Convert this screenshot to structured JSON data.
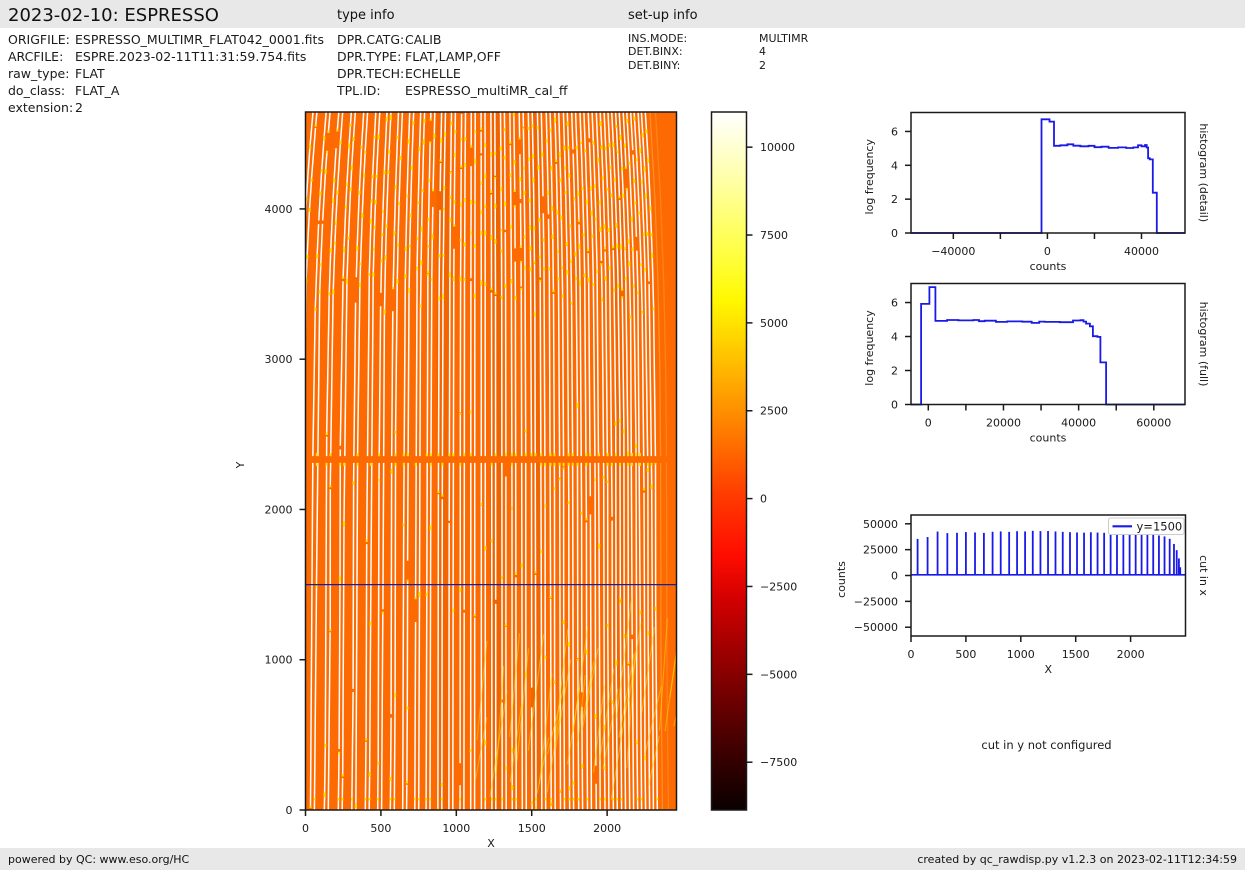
{
  "header": {
    "title": "2023-02-10: ESPRESSO",
    "type_info_label": "type info",
    "setup_info_label": "set-up info"
  },
  "file_info": {
    "rows": [
      {
        "label": "ORIGFILE:",
        "value": "ESPRESSO_MULTIMR_FLAT042_0001.fits"
      },
      {
        "label": "ARCFILE:",
        "value": "ESPRE.2023-02-11T11:31:59.754.fits"
      },
      {
        "label": "raw_type:",
        "value": "FLAT"
      },
      {
        "label": "do_class:",
        "value": "FLAT_A"
      },
      {
        "label": "extension:",
        "value": "2"
      }
    ]
  },
  "type_info": {
    "rows": [
      {
        "label": "DPR.CATG:",
        "value": "CALIB"
      },
      {
        "label": "DPR.TYPE:",
        "value": "FLAT,LAMP,OFF"
      },
      {
        "label": "DPR.TECH:",
        "value": "ECHELLE"
      },
      {
        "label": "TPL.ID:",
        "value": "ESPRESSO_multiMR_cal_ff"
      }
    ]
  },
  "setup_info": {
    "rows": [
      {
        "label": "INS.MODE:",
        "value": "MULTIMR"
      },
      {
        "label": "DET.BINX:",
        "value": "4"
      },
      {
        "label": "DET.BINY:",
        "value": "2"
      }
    ]
  },
  "footer": {
    "left": "powered by QC: www.eso.org/HC",
    "right": "created by qc_rawdisp.py v1.2.3 on 2023-02-11T12:34:59"
  },
  "notes": {
    "cut_in_y": "cut in y not configured"
  },
  "colors": {
    "bar_gray": "#e8e8e8",
    "axis_black": "#1a1a1a",
    "curve_blue": "#1a1ae8",
    "cut_line_blue": "#1c1c9e",
    "frame_orange": "#fc6a01",
    "stripe_white": "#ffffff",
    "stripe_yellow": "#ffdf00"
  },
  "chart_data": [
    {
      "id": "raw_frame",
      "type": "heatmap",
      "description": "raw ESPRESSO flat-field frame: bright echelle orders as near-vertical white stripes on orange background",
      "xlabel": "X",
      "ylabel": "Y",
      "xlim": [
        0,
        2460
      ],
      "ylim": [
        0,
        4645
      ],
      "xticks": [
        0,
        500,
        1000,
        1500,
        2000
      ],
      "yticks": [
        0,
        1000,
        2000,
        3000,
        4000
      ],
      "background_counts": 1400,
      "order_peak_counts": 43000,
      "order_positions_x": [
        60,
        151,
        242,
        331,
        419,
        500,
        583,
        664,
        743,
        817,
        894,
        966,
        1039,
        1109,
        1179,
        1248,
        1316,
        1382,
        1448,
        1512,
        1576,
        1638,
        1699,
        1759,
        1818,
        1876,
        1934,
        1991,
        2046,
        2100,
        2153,
        2206,
        2258,
        2309,
        2356,
        2395,
        2420,
        2440,
        2452
      ],
      "order_pair_separation": 26,
      "detector_gap_y": [
        2310,
        2355
      ],
      "cut_line": {
        "y": 1500,
        "label": "y=1500"
      }
    },
    {
      "id": "colorbar",
      "type": "colorbar",
      "colormap": "hot",
      "vmin": -8860,
      "vmax": 11000,
      "ticks": [
        10000,
        7500,
        5000,
        2500,
        0,
        -2500,
        -5000,
        -7500
      ],
      "stops": [
        [
          0.0,
          "#0a0000"
        ],
        [
          0.1,
          "#470000"
        ],
        [
          0.2,
          "#8b0000"
        ],
        [
          0.3,
          "#d10000"
        ],
        [
          0.365,
          "#ff0c00"
        ],
        [
          0.45,
          "#ff3b00"
        ],
        [
          0.55,
          "#ff8100"
        ],
        [
          0.65,
          "#ffc300"
        ],
        [
          0.73,
          "#fff800"
        ],
        [
          0.8,
          "#ffff45"
        ],
        [
          0.9,
          "#ffffa4"
        ],
        [
          1.0,
          "#ffffff"
        ]
      ]
    },
    {
      "id": "histogram_detail",
      "type": "line",
      "side_label": "histogram (detail)",
      "xlabel": "counts",
      "ylabel": "log frequency",
      "xlim": [
        -58000,
        58500
      ],
      "ylim": [
        0,
        7.12
      ],
      "xtick_marks": [
        -40000,
        -20000,
        0,
        20000,
        40000
      ],
      "xtick_labels": [
        -40000,
        0,
        40000
      ],
      "yticks": [
        0,
        2,
        4,
        6
      ],
      "points": [
        [
          -58000,
          0
        ],
        [
          -2500,
          0
        ],
        [
          -2500,
          6.72
        ],
        [
          900,
          6.72
        ],
        [
          900,
          6.58
        ],
        [
          2800,
          6.58
        ],
        [
          2800,
          5.15
        ],
        [
          5500,
          5.15
        ],
        [
          5500,
          5.18
        ],
        [
          8500,
          5.18
        ],
        [
          8500,
          5.24
        ],
        [
          11000,
          5.24
        ],
        [
          11000,
          5.16
        ],
        [
          14000,
          5.16
        ],
        [
          14000,
          5.12
        ],
        [
          17500,
          5.12
        ],
        [
          17500,
          5.15
        ],
        [
          20000,
          5.15
        ],
        [
          20000,
          5.07
        ],
        [
          23000,
          5.07
        ],
        [
          23000,
          5.1
        ],
        [
          26000,
          5.1
        ],
        [
          26000,
          5.03
        ],
        [
          30000,
          5.03
        ],
        [
          30000,
          5.06
        ],
        [
          33500,
          5.06
        ],
        [
          33500,
          5.02
        ],
        [
          36500,
          5.02
        ],
        [
          36500,
          5.06
        ],
        [
          38500,
          5.06
        ],
        [
          38500,
          5.18
        ],
        [
          40000,
          5.18
        ],
        [
          40000,
          5.12
        ],
        [
          41500,
          5.12
        ],
        [
          41500,
          5.2
        ],
        [
          42200,
          5.2
        ],
        [
          42200,
          5.05
        ],
        [
          42800,
          5.05
        ],
        [
          42800,
          4.42
        ],
        [
          43500,
          4.42
        ],
        [
          43500,
          4.35
        ],
        [
          44800,
          4.35
        ],
        [
          44800,
          2.38
        ],
        [
          46500,
          2.38
        ],
        [
          46500,
          0
        ],
        [
          58500,
          0
        ]
      ]
    },
    {
      "id": "histogram_full",
      "type": "line",
      "side_label": "histogram (full)",
      "xlabel": "counts",
      "ylabel": "log frequency",
      "xlim": [
        -4600,
        68300
      ],
      "ylim": [
        0,
        7.12
      ],
      "xtick_marks": [
        0,
        10000,
        20000,
        30000,
        40000,
        50000,
        60000
      ],
      "xtick_labels": [
        0,
        20000,
        40000,
        60000
      ],
      "yticks": [
        0,
        2,
        4,
        6
      ],
      "points": [
        [
          -4600,
          0
        ],
        [
          -1900,
          0
        ],
        [
          -1900,
          5.92
        ],
        [
          300,
          5.92
        ],
        [
          300,
          6.91
        ],
        [
          1900,
          6.91
        ],
        [
          1900,
          4.92
        ],
        [
          5000,
          4.92
        ],
        [
          5000,
          4.97
        ],
        [
          8000,
          4.97
        ],
        [
          8000,
          4.95
        ],
        [
          12000,
          4.95
        ],
        [
          12000,
          4.97
        ],
        [
          13500,
          4.97
        ],
        [
          13500,
          4.9
        ],
        [
          15000,
          4.9
        ],
        [
          15000,
          4.93
        ],
        [
          18000,
          4.93
        ],
        [
          18000,
          4.86
        ],
        [
          21000,
          4.86
        ],
        [
          21000,
          4.89
        ],
        [
          25000,
          4.89
        ],
        [
          25000,
          4.87
        ],
        [
          27500,
          4.87
        ],
        [
          27500,
          4.8
        ],
        [
          29500,
          4.8
        ],
        [
          29500,
          4.88
        ],
        [
          31000,
          4.88
        ],
        [
          31000,
          4.86
        ],
        [
          35000,
          4.86
        ],
        [
          35000,
          4.84
        ],
        [
          38500,
          4.84
        ],
        [
          38500,
          4.94
        ],
        [
          40500,
          4.94
        ],
        [
          40500,
          4.96
        ],
        [
          41300,
          4.96
        ],
        [
          41300,
          4.88
        ],
        [
          42000,
          4.88
        ],
        [
          42000,
          4.76
        ],
        [
          43000,
          4.76
        ],
        [
          43000,
          4.6
        ],
        [
          43800,
          4.6
        ],
        [
          43800,
          4.02
        ],
        [
          45000,
          4.02
        ],
        [
          45000,
          3.98
        ],
        [
          45800,
          3.98
        ],
        [
          45800,
          2.48
        ],
        [
          47300,
          2.48
        ],
        [
          47300,
          0
        ],
        [
          68300,
          0
        ]
      ]
    },
    {
      "id": "cut_in_x",
      "type": "spikes",
      "side_label": "cut in x",
      "legend": "y=1500",
      "xlabel": "X",
      "ylabel": "counts",
      "xlim": [
        0,
        2500
      ],
      "ylim": [
        -58500,
        58500
      ],
      "xticks": [
        0,
        500,
        1000,
        1500,
        2000
      ],
      "yticks": [
        50000,
        25000,
        0,
        -25000,
        -50000
      ],
      "baseline_counts": 700,
      "spike_x": [
        60,
        151,
        242,
        331,
        419,
        500,
        583,
        664,
        743,
        817,
        894,
        966,
        1039,
        1109,
        1179,
        1248,
        1316,
        1382,
        1448,
        1512,
        1576,
        1638,
        1699,
        1759,
        1818,
        1876,
        1934,
        1991,
        2046,
        2100,
        2153,
        2206,
        2258,
        2309,
        2356,
        2395,
        2420,
        2440,
        2452
      ],
      "spike_h": [
        35400,
        37200,
        42500,
        41000,
        41300,
        42000,
        41600,
        41200,
        42300,
        42600,
        42200,
        42800,
        42600,
        43200,
        42900,
        43000,
        42600,
        42200,
        41900,
        41600,
        41400,
        41800,
        41500,
        41300,
        41100,
        41400,
        41000,
        40800,
        40500,
        40200,
        39800,
        39300,
        38700,
        37800,
        35500,
        30500,
        24500,
        16500,
        8000
      ]
    }
  ]
}
